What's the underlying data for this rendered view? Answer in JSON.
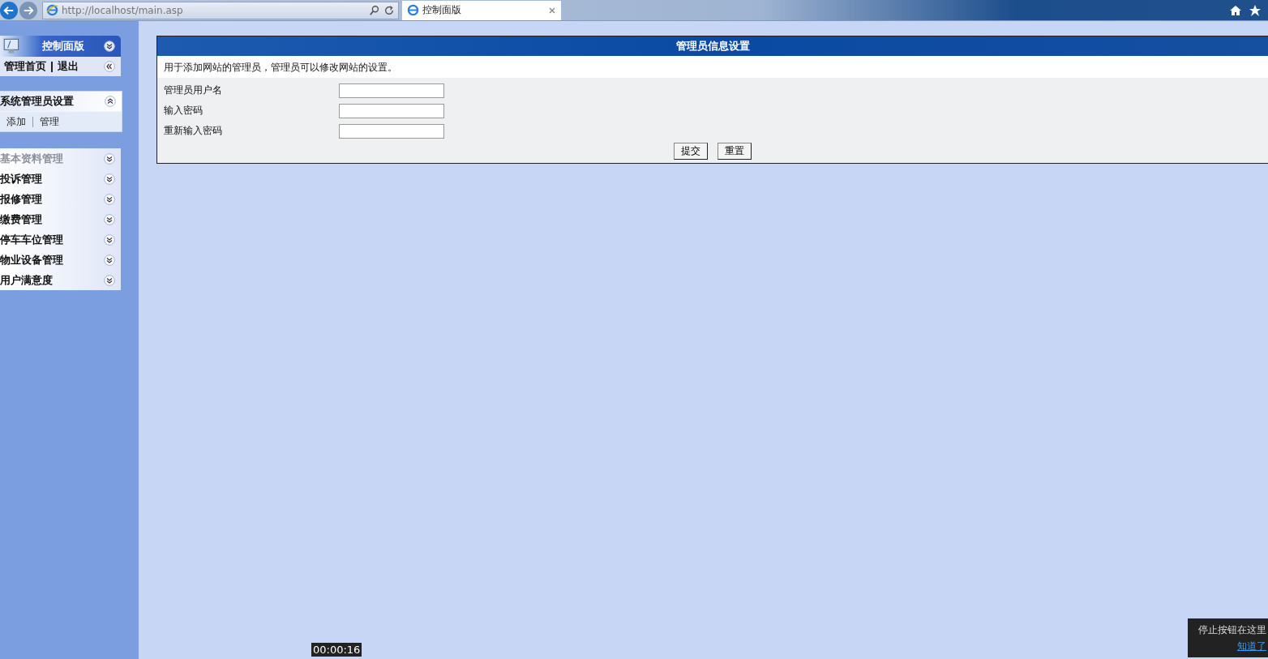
{
  "browser": {
    "url": "http://localhost/main.asp",
    "tab_title": "控制面版"
  },
  "sidebar": {
    "panel_title": "控制面版",
    "panel_links": [
      "管理首页",
      "退出"
    ],
    "sections": [
      {
        "title": "系统管理员设置",
        "expanded": true,
        "disabled": false,
        "links": [
          "添加",
          "管理"
        ]
      },
      {
        "title": "基本资料管理",
        "expanded": false,
        "disabled": true
      },
      {
        "title": "投诉管理",
        "expanded": false,
        "disabled": false
      },
      {
        "title": "报修管理",
        "expanded": false,
        "disabled": false
      },
      {
        "title": "缴费管理",
        "expanded": false,
        "disabled": false
      },
      {
        "title": "停车车位管理",
        "expanded": false,
        "disabled": false
      },
      {
        "title": "物业设备管理",
        "expanded": false,
        "disabled": false
      },
      {
        "title": "用户满意度",
        "expanded": false,
        "disabled": false
      }
    ]
  },
  "form": {
    "title": "管理员信息设置",
    "description": "用于添加网站的管理员，管理员可以修改网站的设置。",
    "fields": [
      {
        "label": "管理员用户名"
      },
      {
        "label": "输入密码"
      },
      {
        "label": "重新输入密码"
      }
    ],
    "buttons": [
      "提交",
      "重置"
    ]
  },
  "recorder": {
    "timer": "00:00:16",
    "tip": "停止按钮在这里",
    "tip_link": "知道了"
  }
}
